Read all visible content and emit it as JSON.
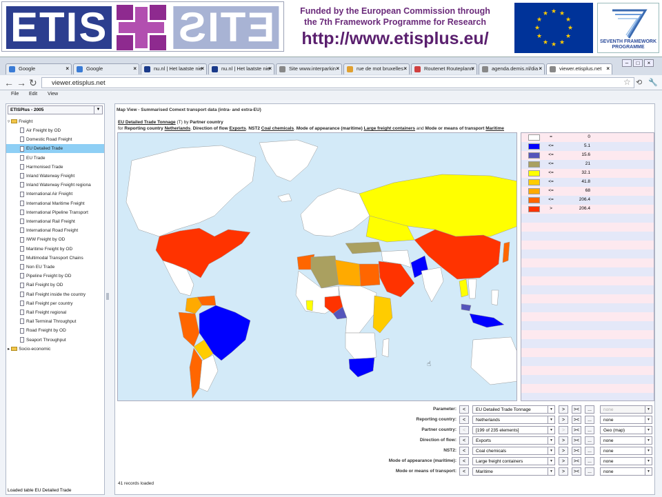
{
  "banner": {
    "logo_text_left": "ETIS",
    "logo_text_right": "ETIS",
    "funded_line1": "Funded by the European Commission through",
    "funded_line2": "the 7th Framework Programme for Research",
    "url": "http://www.etisplus.eu/",
    "fp7_text": "SEVENTH FRAMEWORK PROGRAMME"
  },
  "tabs": [
    {
      "label": "Google",
      "color": "#3a7bd5"
    },
    {
      "label": "Google",
      "color": "#3a7bd5"
    },
    {
      "label": "nu.nl | Het laatste nie",
      "color": "#1a3a8a"
    },
    {
      "label": "nu.nl | Het laatste nie",
      "color": "#1a3a8a"
    },
    {
      "label": "Site www.interparkin",
      "color": "#888888"
    },
    {
      "label": "rue de mot bruxelles",
      "color": "#e0a030"
    },
    {
      "label": "Routenet Routeplann",
      "color": "#d04040"
    },
    {
      "label": "agenda.demis.nl/dia",
      "color": "#888888"
    },
    {
      "label": "viewer.etisplus.net",
      "color": "#888888"
    }
  ],
  "address": {
    "url": "viewer.etisplus.net"
  },
  "menu": [
    "File",
    "Edit",
    "View"
  ],
  "sidebar": {
    "combo": "ETISPlus - 2005",
    "root": "Freight",
    "items": [
      "Air Freight by OD",
      "Domestic Road Freight",
      "EU Detailed Trade",
      "EU Trade",
      "Harmonised Trade",
      "Inland Waterway Freight",
      "Inland Waterway Freight regiona",
      "International Air Freight",
      "International Maritime Freight",
      "International Pipeline Transport",
      "International Rail Freight",
      "International Road Freight",
      "IWW Freight by OD",
      "Maritime Freight by OD",
      "Multimodal Transport Chains",
      "Non EU Trade",
      "Pipeline Freight by OD",
      "Rail Freight by OD",
      "Rail Freight inside the country",
      "Rail Freight per country",
      "Rail Freight regional",
      "Rail Terminal Throughput",
      "Road Freight by OD",
      "Seaport Throughput"
    ],
    "selected_index": 2,
    "second_root": "Socio-economic",
    "status": "Loaded table EU Detailed Trade"
  },
  "map": {
    "title": "Map View - Summarised Comext transport data (intra- and extra-EU)",
    "desc_line1_parts": [
      "EU Detailed Trade Tonnage",
      " (T) by ",
      "Partner country"
    ],
    "desc_line2_parts": [
      "for ",
      "Reporting country",
      " ",
      "Netherlands",
      ". ",
      "Direction of flow",
      " ",
      "Exports",
      ". ",
      "NST2",
      " ",
      "Coal chemicals",
      ". ",
      "Mode of appearance (maritime)",
      " ",
      "Large freight containers",
      " and ",
      "Mode or means of transport",
      " ",
      "Maritime"
    ],
    "ocean_color": "#d3eaf8",
    "no_data_color": "#ffffff"
  },
  "legend": [
    {
      "op": "=",
      "value": "0",
      "color": "#ffffff"
    },
    {
      "op": "<=",
      "value": "5.1",
      "color": "#0000ff"
    },
    {
      "op": "<=",
      "value": "15.6",
      "color": "#5555bb"
    },
    {
      "op": "<=",
      "value": "21",
      "color": "#aaa060"
    },
    {
      "op": "<=",
      "value": "32.1",
      "color": "#ffff00"
    },
    {
      "op": "<=",
      "value": "41.8",
      "color": "#ffcc00"
    },
    {
      "op": "<=",
      "value": "68",
      "color": "#ffaa00"
    },
    {
      "op": "<=",
      "value": "206.4",
      "color": "#ff6600"
    },
    {
      "op": ">",
      "value": "206.4",
      "color": "#ff3300"
    }
  ],
  "filters": [
    {
      "label": "Parameter:",
      "value": "EU Detailed Trade Tonnage",
      "extra": "none",
      "extra_disabled": true,
      "prev_disabled": false,
      "next_disabled": false
    },
    {
      "label": "Reporting country:",
      "value": "Netherlands",
      "extra": "none",
      "extra_disabled": false,
      "prev_disabled": false,
      "next_disabled": false
    },
    {
      "label": "Partner country:",
      "value": "[199 of 235 elements]",
      "extra": "Geo (map)",
      "extra_disabled": false,
      "prev_disabled": true,
      "next_disabled": true
    },
    {
      "label": "Direction of flow:",
      "value": "Exports",
      "extra": "none",
      "extra_disabled": false,
      "prev_disabled": false,
      "next_disabled": false
    },
    {
      "label": "NST2:",
      "value": "Coal chemicals",
      "extra": "none",
      "extra_disabled": false,
      "prev_disabled": false,
      "next_disabled": false
    },
    {
      "label": "Mode of appearance (maritime):",
      "value": "Large freight containers",
      "extra": "none",
      "extra_disabled": false,
      "prev_disabled": false,
      "next_disabled": false
    },
    {
      "label": "Mode or means of transport:",
      "value": "Maritime",
      "extra": "none",
      "extra_disabled": false,
      "prev_disabled": false,
      "next_disabled": false
    }
  ],
  "buttons": {
    "prev": "<",
    "next": ">",
    "split": "><",
    "more": "..."
  },
  "records": "41 records loaded"
}
